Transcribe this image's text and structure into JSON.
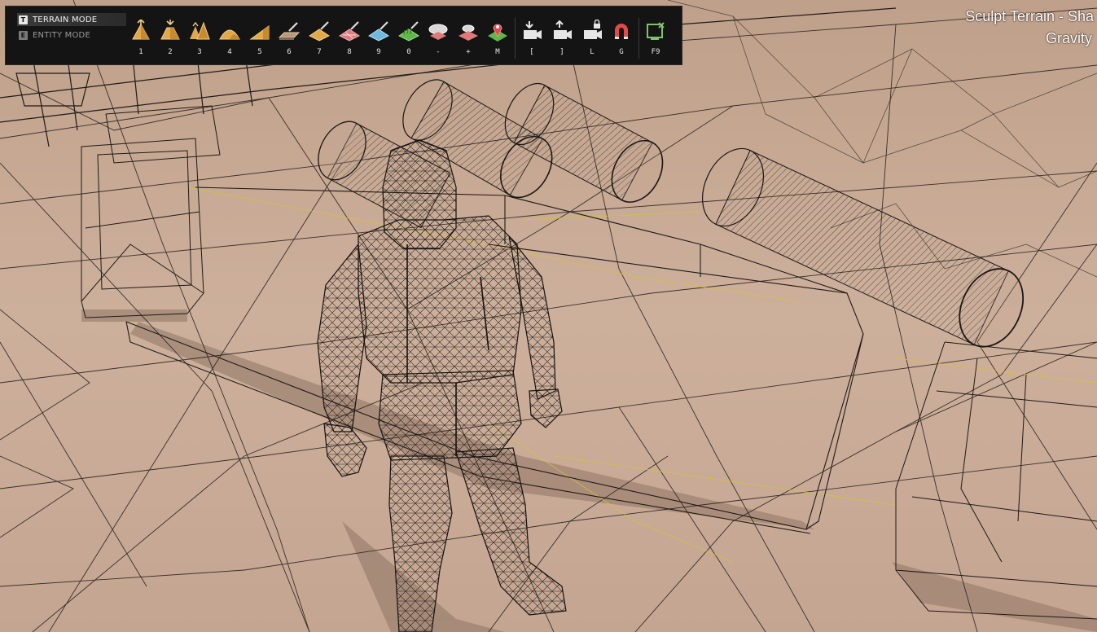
{
  "hud": {
    "title": "Sculpt Terrain - Sha",
    "subtitle": "Gravity"
  },
  "modes": [
    {
      "key": "T",
      "label": "TERRAIN MODE",
      "active": true
    },
    {
      "key": "E",
      "label": "ENTITY MODE",
      "active": false
    }
  ],
  "tools": [
    {
      "key": "1",
      "icon": "raise-terrain-icon"
    },
    {
      "key": "2",
      "icon": "lower-terrain-icon"
    },
    {
      "key": "3",
      "icon": "sharpen-peaks-icon"
    },
    {
      "key": "4",
      "icon": "smooth-terrain-icon"
    },
    {
      "key": "5",
      "icon": "slope-terrain-icon"
    },
    {
      "key": "6",
      "icon": "flatten-terrain-icon"
    },
    {
      "key": "7",
      "icon": "paint-sand-icon"
    },
    {
      "key": "8",
      "icon": "paint-rock-icon"
    },
    {
      "key": "9",
      "icon": "paint-water-icon"
    },
    {
      "key": "0",
      "icon": "paint-grass-icon"
    },
    {
      "key": "-",
      "icon": "decrease-brush-icon"
    },
    {
      "key": "+",
      "icon": "increase-brush-icon"
    },
    {
      "key": "M",
      "icon": "map-marker-icon"
    },
    {
      "key": "[",
      "icon": "camera-down-icon"
    },
    {
      "key": "]",
      "icon": "camera-up-icon"
    },
    {
      "key": "L",
      "icon": "camera-lock-icon"
    },
    {
      "key": "G",
      "icon": "magnet-snap-icon"
    },
    {
      "key": "F9",
      "icon": "export-screen-icon"
    }
  ],
  "colors": {
    "toolbar_bg": "#141414",
    "ground": "#c9ab97",
    "wire": "#1e1a17",
    "yellow_wire": "#d8c23a",
    "accent_green": "#7cc36b",
    "magnet_red": "#e04a4a"
  }
}
